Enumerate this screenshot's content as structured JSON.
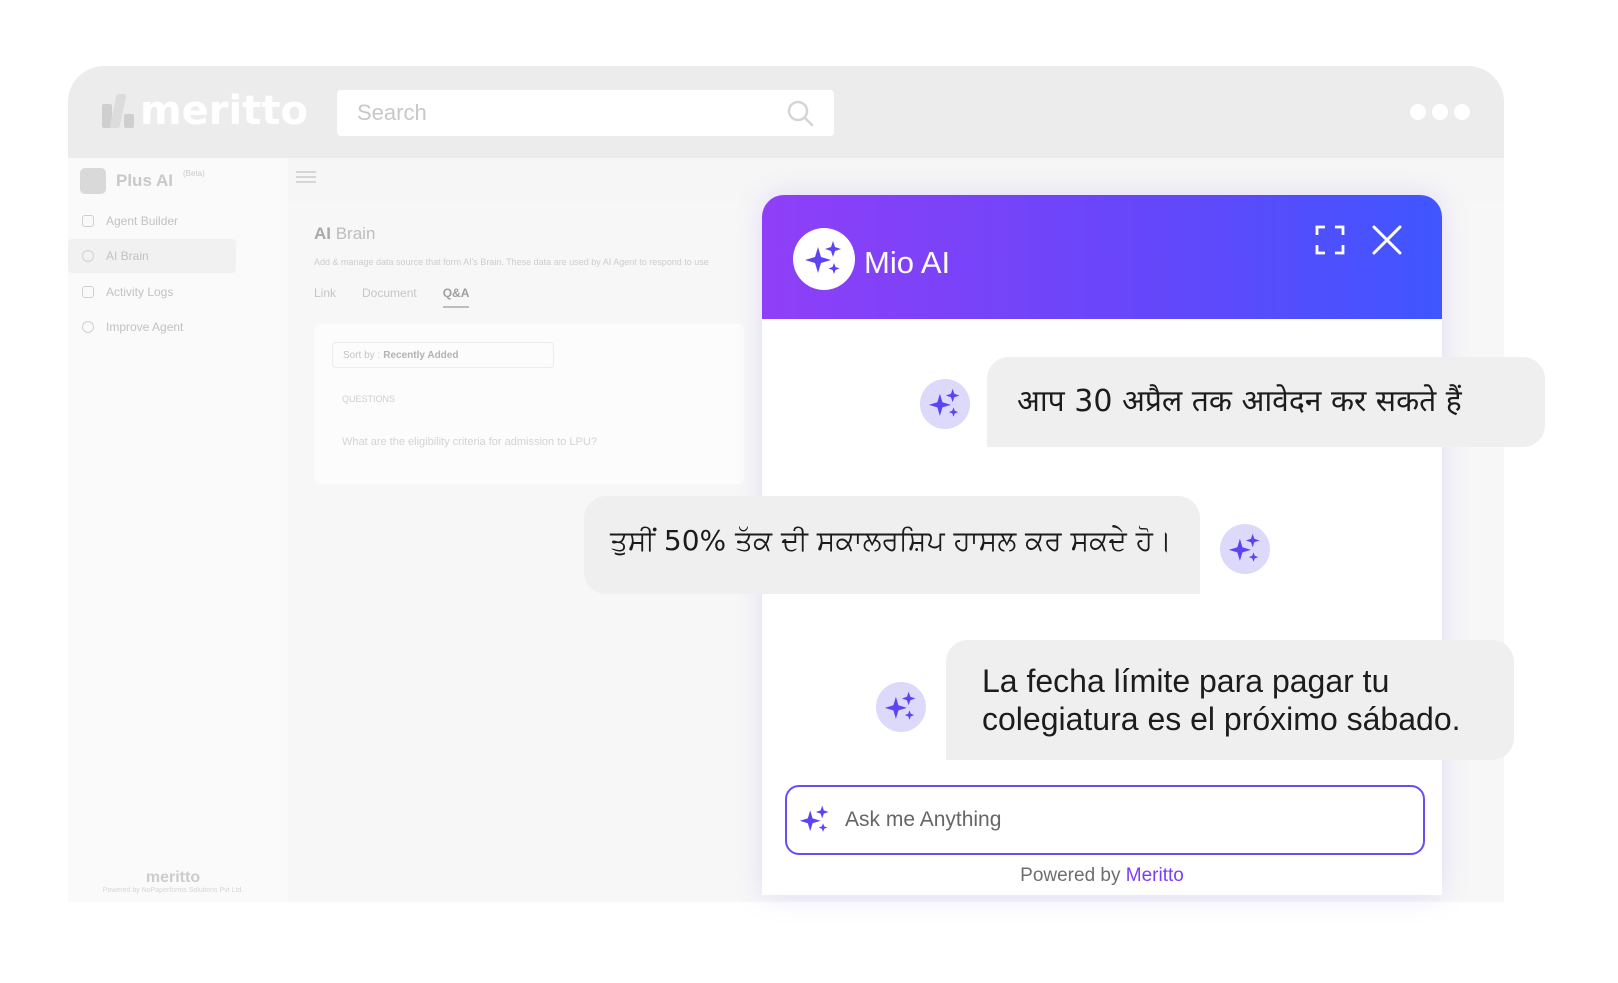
{
  "browser": {
    "logo": "meritto",
    "search_placeholder": "Search"
  },
  "sidebar": {
    "title": "Plus AI",
    "beta": "(Beta)",
    "items": [
      {
        "label": "Agent Builder"
      },
      {
        "label": "AI Brain"
      },
      {
        "label": "Activity Logs"
      },
      {
        "label": "Improve Agent"
      }
    ],
    "footer_logo": "meritto",
    "footer_text": "Powered by NoPaperforms Solutions Pvt Ltd."
  },
  "main": {
    "title_bold": "AI",
    "title_rest": " Brain",
    "subtitle": "Add & manage data source that form AI's Brain. These data are used by AI Agent to respond to use",
    "tabs": [
      {
        "label": "Link"
      },
      {
        "label": "Document"
      },
      {
        "label": "Q&A"
      }
    ],
    "sort_prefix": "Sort by :",
    "sort_value": "Recently Added",
    "questions_header": "QUESTIONS",
    "question_1": "What are the eligibility criteria for admission to LPU?"
  },
  "chat": {
    "title": "Mio AI",
    "messages": [
      {
        "text": "आप 30 अप्रैल तक आवेदन कर सकते हैं"
      },
      {
        "text": "ਤੁਸੀਂ 50% ਤੱਕ ਦੀ ਸਕਾਲਰਸ਼ਿਪ ਹਾਸਲ ਕਰ ਸਕਦੇ ਹੋ।"
      },
      {
        "text": "La fecha límite para pagar tu\ncolegiatura es el próximo sábado."
      }
    ],
    "input_placeholder": "Ask me Anything",
    "powered_prefix": "Powered by ",
    "powered_brand": "Meritto"
  },
  "colors": {
    "header_gradient_start": "#8f3ff7",
    "header_gradient_end": "#3f56ff",
    "accent": "#6a4ef5",
    "brand_link": "#7a3ff5",
    "bubble_bg": "#efefef",
    "avatar_bg": "#dcd9fb"
  },
  "icons": [
    "sparkle-icon",
    "expand-icon",
    "close-icon",
    "search-icon",
    "more-dots-icon"
  ]
}
